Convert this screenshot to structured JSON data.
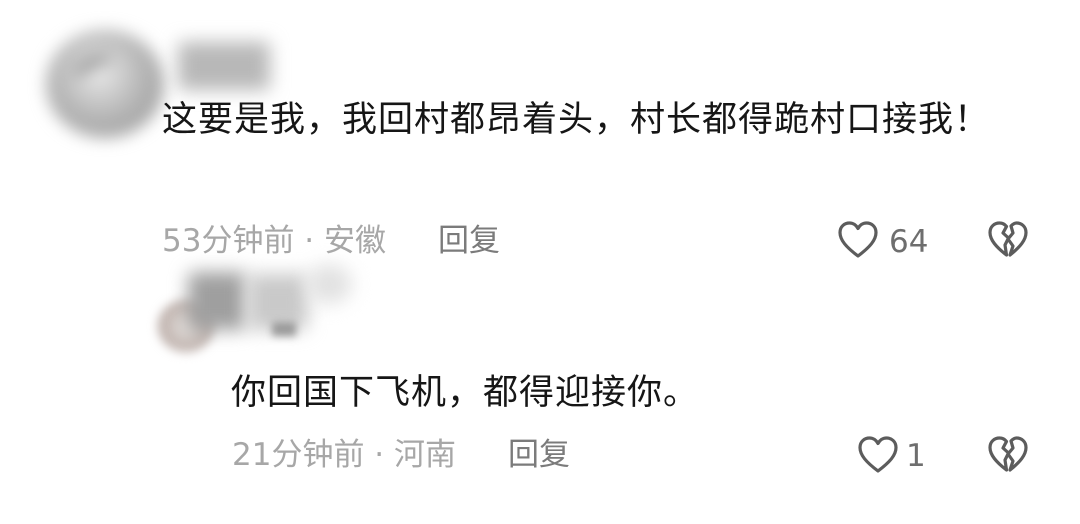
{
  "comments": [
    {
      "text": "这要是我，我回村都昂着头，村长都得跪村口接我！",
      "meta": "53分钟前 · 安徽",
      "reply_label": "回复",
      "likes": "64"
    }
  ],
  "reply": {
    "text": "你回国下飞机，都得迎接你。",
    "meta": "21分钟前 · 河南",
    "reply_label": "回复",
    "likes": "1"
  },
  "icons": {
    "like": "heart-outline-icon",
    "dislike": "broken-heart-icon"
  },
  "colors": {
    "text": "#161616",
    "meta": "#a7a7a7",
    "icon": "#5c5c5c"
  }
}
